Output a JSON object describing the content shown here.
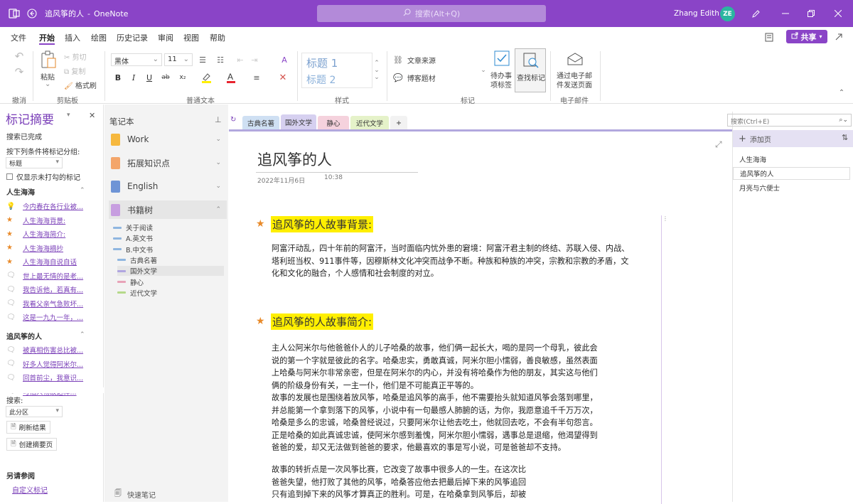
{
  "titlebar": {
    "app": "OneNote",
    "doc": "追风筝的人",
    "separator": "-",
    "search_placeholder": "搜索(Alt+Q)",
    "user": "Zhang Edith",
    "initials": "ZE"
  },
  "menu": [
    "文件",
    "开始",
    "插入",
    "绘图",
    "历史记录",
    "审阅",
    "视图",
    "帮助"
  ],
  "share_label": "共享",
  "ribbon": {
    "undo_group": "撤消",
    "clipboard": {
      "paste": "粘贴",
      "cut": "剪切",
      "copy": "复制",
      "format_painter": "格式刷",
      "group": "剪贴板"
    },
    "font": {
      "name": "黑体",
      "size": "11",
      "group": "普通文本"
    },
    "styles": {
      "h1": "标题 1",
      "h2": "标题 2",
      "group": "样式"
    },
    "tags": {
      "source": "文章来源",
      "blog": "博客题材",
      "todo_line1": "待办事",
      "todo_line2": "项标签",
      "find": "查找标记",
      "group": "标记"
    },
    "email": {
      "line1": "通过电子邮",
      "line2": "件发送页面",
      "group": "电子邮件"
    }
  },
  "summary": {
    "title": "标记摘要",
    "status": "搜索已完成",
    "group_by_label": "按下列条件将标记分组:",
    "group_by_value": "标题",
    "unchecked_only": "仅显示未打勾的标记",
    "groups": [
      {
        "name": "人生海海",
        "items": [
          {
            "icon": "bulb-icon",
            "text": "今内春在各行业被..."
          },
          {
            "icon": "star-icon",
            "text": "人生海海背景:"
          },
          {
            "icon": "star-icon",
            "text": "人生海海简介:"
          },
          {
            "icon": "star-icon",
            "text": "人生海海摘抄"
          },
          {
            "icon": "star-icon",
            "text": "人生海海自说自话"
          },
          {
            "icon": "comment-icon",
            "text": "世上最无情的是老..."
          },
          {
            "icon": "comment-icon",
            "text": "我告诉他，若真有..."
          },
          {
            "icon": "comment-icon",
            "text": "我看父亲气急败坏..."
          },
          {
            "icon": "comment-icon",
            "text": "这是一九九一年，..."
          }
        ]
      },
      {
        "name": "追风筝的人",
        "items": [
          {
            "icon": "comment-icon",
            "text": "被真相伤害总比被..."
          },
          {
            "icon": "comment-icon",
            "text": "好多人觉得阿米尔..."
          },
          {
            "icon": "comment-icon",
            "text": "回首前尘，我意识..."
          },
          {
            "icon": "comment-icon",
            "text": "可怕人物故这样..."
          }
        ]
      }
    ],
    "search_label": "搜索:",
    "scope_value": "此分区",
    "refresh": "刷新结果",
    "create": "创建摘要页",
    "see_also": "另请参阅",
    "customize": "自定义标记"
  },
  "notebooks": {
    "header": "笔记本",
    "items": [
      {
        "name": "Work",
        "color": "#f6b83e"
      },
      {
        "name": "拓展知识点",
        "color": "#f3a56a"
      },
      {
        "name": "English",
        "color": "#6e94d6"
      },
      {
        "name": "书籍树",
        "color": "#c79ee0"
      }
    ],
    "sections": [
      {
        "name": "关于阅读",
        "color": "#8fb6e0",
        "indent": 0
      },
      {
        "name": "A.英文书",
        "color": "#8fb6e0",
        "indent": 0
      },
      {
        "name": "B.中文书",
        "color": "#8fb6e0",
        "indent": 0
      },
      {
        "name": "古典名著",
        "color": "#8fb6e0",
        "indent": 1
      },
      {
        "name": "国外文学",
        "color": "#b0a6e0",
        "indent": 1
      },
      {
        "name": "静心",
        "color": "#e8a3b8",
        "indent": 1
      },
      {
        "name": "近代文学",
        "color": "#b5d98a",
        "indent": 1
      }
    ],
    "quick_notes": "快速笔记"
  },
  "tabs": [
    {
      "label": "古典名著",
      "color": "#cfe0f3"
    },
    {
      "label": "国外文学",
      "color": "#d6d0f0"
    },
    {
      "label": "静心",
      "color": "#f5d2dd"
    },
    {
      "label": "近代文学",
      "color": "#e5f2c9"
    },
    {
      "label": "+",
      "color": "#f2f2f2"
    }
  ],
  "page": {
    "title": "追风筝的人",
    "date": "2022年11月6日",
    "time": "10:38",
    "heading1": "追风筝的人故事背景:",
    "para1": "阿富汗动乱，四十年前的阿富汗，当时面临内忧外患的窘境：阿富汗君主制的终结、苏联入侵、内战、\n塔利班当权、911事件等，因穆斯林文化冲突而战争不断。种族和种族的冲突，宗教和宗教的矛盾，文\n化和文化的融合，个人感情和社会制度的对立。",
    "heading2": "追风筝的人故事简介:",
    "para2": "主人公阿米尔与他爸爸仆人的儿子哈桑的故事，他们俩一起长大，喝的是同一个母乳，彼此会\n说的第一个字就是彼此的名字。哈桑忠实，勇敢真诚，阿米尔胆小懦弱，善良敏感，虽然表面\n上哈桑与阿米尔非常亲密，但是在阿米尔的内心，并没有将哈桑作为他的朋友，其实这与他们\n俩的阶级身份有关，一主一仆，他们是不可能真正平等的。\n故事的发展也是围绕着放风筝，哈桑是追风筝的高手，他不需要抬头就知道风筝会落到哪里，\n并总能第一个拿到落下的风筝，小说中有一句最感人肺腑的话，为你，我愿意追千千万万次，\n哈桑是多么的忠诚，哈桑曾经说过，只要阿米尔让他去吃土，他就回去吃，不会有半句怨言。\n正是哈桑的如此真诚忠诚，使阿米尔感到羞愧，阿米尔胆小懦弱，遇事总是退缩，他渴望得到\n爸爸的爱，却又无法做到爸爸的要求，他最喜欢的事是写小说，可是爸爸却不支持。",
    "para3": "故事的转折点是一次风筝比赛，它改变了故事中很多人的一生。在这次比\n爸爸失望，他打败了其他的风筝，哈桑答应他去把最后掉下来的风筝追回\n只有追到掉下来的风筝才算真正的胜利。可是，在哈桑拿到风筝后，却被"
  },
  "pagelist": {
    "search_placeholder": "搜索(Ctrl+E)",
    "add_page": "添加页",
    "pages": [
      "人生海海",
      "追风筝的人",
      "月亮与六便士"
    ]
  }
}
